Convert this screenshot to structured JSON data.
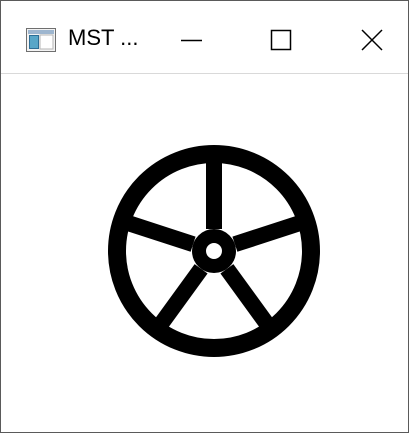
{
  "window": {
    "title": "MST ...",
    "controls": {
      "minimize_icon": "minimize-icon",
      "maximize_icon": "maximize-icon",
      "close_icon": "close-icon"
    }
  },
  "canvas": {
    "drawing": "wheel-icon",
    "spoke_count": 5,
    "color": "#000000",
    "background": "#ffffff"
  }
}
